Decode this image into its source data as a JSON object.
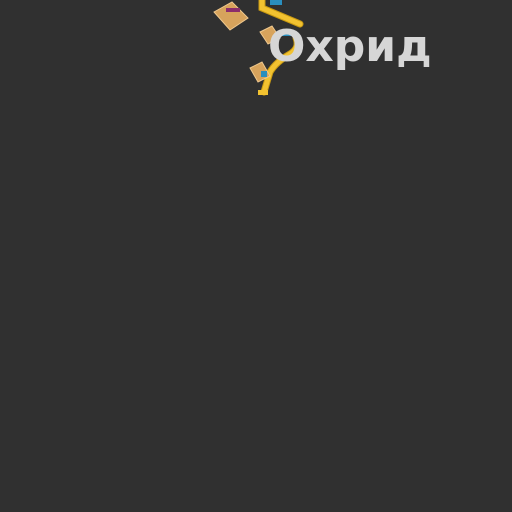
{
  "map": {
    "city_label": "Охрид",
    "colors": {
      "background": "#303030",
      "road_fill": "#f2c230",
      "road_casing": "#c99a12",
      "building_fill": "#d7a35c",
      "building_stroke": "#f0c98e",
      "label_text": "#d6d6d6",
      "poi_marker": "#2a8fbf"
    },
    "layers": [
      "roads",
      "buildings",
      "poi-markers",
      "place-labels"
    ]
  }
}
